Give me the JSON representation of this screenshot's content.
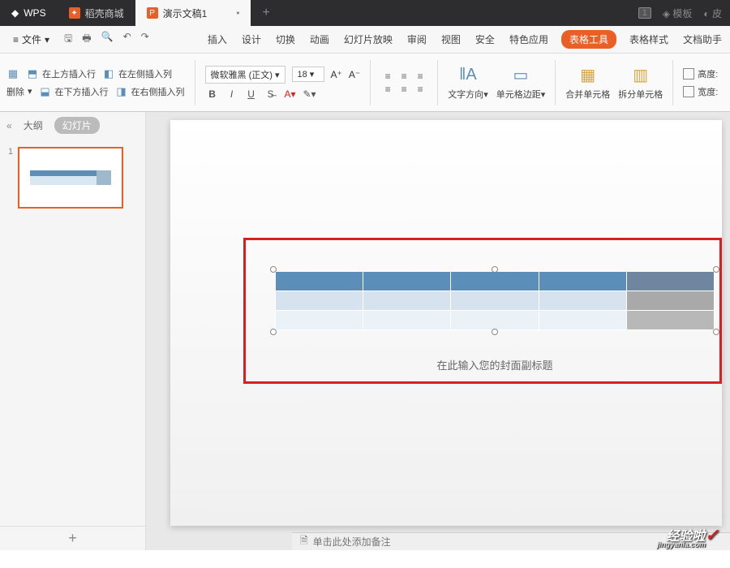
{
  "titlebar": {
    "app": "WPS",
    "tab_store": "稻壳商城",
    "tab_doc": "演示文稿1",
    "plus": "+",
    "badge": "1",
    "template": "模板",
    "skin": "皮"
  },
  "menu": {
    "file": "文件",
    "items": [
      "插入",
      "设计",
      "切换",
      "动画",
      "幻灯片放映",
      "审阅",
      "视图",
      "安全",
      "特色应用"
    ],
    "table_tools": "表格工具",
    "table_style": "表格样式",
    "doc_help": "文档助手"
  },
  "ribbon": {
    "insert_above": "在上方插入行",
    "insert_below": "在下方插入行",
    "insert_left": "在左侧插入列",
    "insert_right": "在右侧插入列",
    "delete": "删除",
    "font_name": "微软雅黑 (正文)",
    "font_size": "18",
    "text_dir": "文字方向",
    "cell_margin": "单元格边距",
    "merge": "合并单元格",
    "split": "拆分单元格",
    "height": "高度:",
    "width": "宽度:"
  },
  "sidepanel": {
    "outline": "大纲",
    "slides": "幻灯片",
    "slide_num": "1",
    "add": "+"
  },
  "slide": {
    "subtitle_hint": "在此输入您的封面副标题"
  },
  "notes": {
    "placeholder": "单击此处添加备注"
  },
  "watermark": {
    "text": "经验啦",
    "url": "jingyanla.com"
  },
  "chart_data": {
    "type": "table",
    "rows": 3,
    "cols": 5,
    "selected_col_index": 4,
    "header_color": "#5b8fb9",
    "row_colors": [
      "#5b8fb9",
      "#d6e3ee",
      "#eaf1f7"
    ],
    "selected_col_colors": [
      "#6f86a0",
      "#a9a9a9",
      "#b8b8b8"
    ]
  }
}
